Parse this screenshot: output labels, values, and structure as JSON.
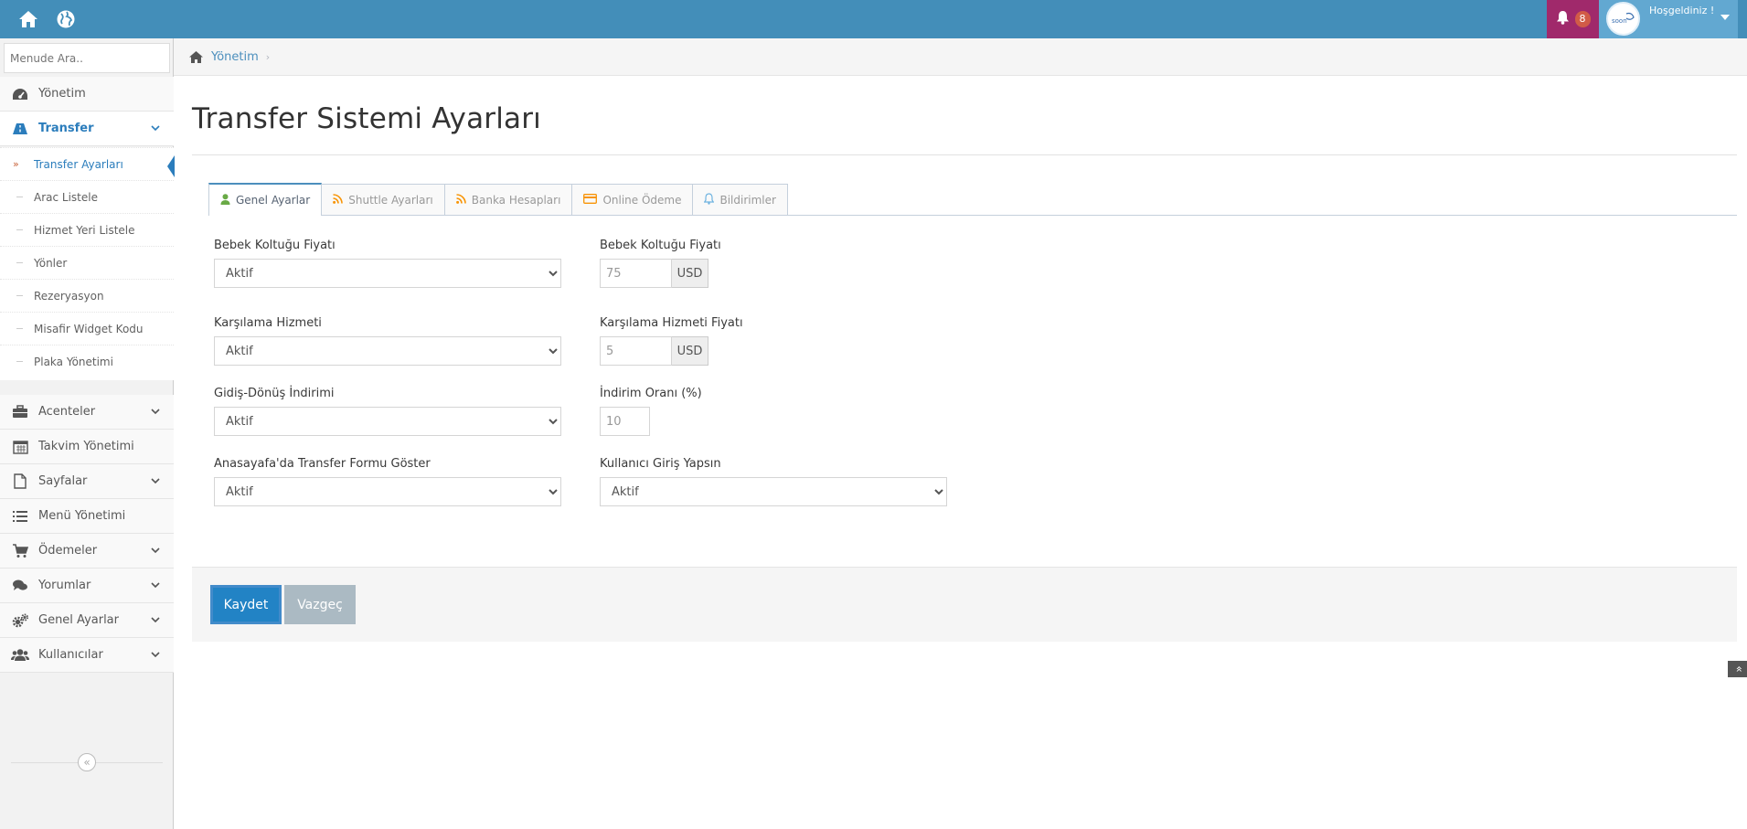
{
  "topbar": {
    "notification_count": "8",
    "welcome_text": "Hoşgeldiniz !",
    "colors": {
      "bar": "#438eb9",
      "notif": "#a0296b",
      "user": "#62a8d1"
    }
  },
  "sidebar": {
    "search_placeholder": "Menude Ara..",
    "items": [
      {
        "label": "Yönetim",
        "icon": "dashboard-icon"
      },
      {
        "label": "Transfer",
        "icon": "road-icon"
      },
      {
        "label": "Acenteler",
        "icon": "briefcase-icon"
      },
      {
        "label": "Takvim Yönetimi",
        "icon": "calendar-icon"
      },
      {
        "label": "Sayfalar",
        "icon": "file-icon"
      },
      {
        "label": "Menü Yönetimi",
        "icon": "list-icon"
      },
      {
        "label": "Ödemeler",
        "icon": "cart-icon"
      },
      {
        "label": "Yorumlar",
        "icon": "comments-icon"
      },
      {
        "label": "Genel Ayarlar",
        "icon": "cogs-icon"
      },
      {
        "label": "Kullanıcılar",
        "icon": "users-icon"
      }
    ],
    "submenu": [
      "Transfer Ayarları",
      "Arac Listele",
      "Hizmet Yeri Listele",
      "Yönler",
      "Rezeryasyon",
      "Misafir Widget Kodu",
      "Plaka Yönetimi"
    ]
  },
  "breadcrumb": {
    "home": "Yönetim"
  },
  "page": {
    "title": "Transfer Sistemi Ayarları"
  },
  "tabs": [
    {
      "label": "Genel Ayarlar",
      "icon": "user-icon"
    },
    {
      "label": "Shuttle Ayarları",
      "icon": "rss-icon"
    },
    {
      "label": "Banka Hesapları",
      "icon": "rss-icon"
    },
    {
      "label": "Online Ödeme",
      "icon": "credit-card-icon"
    },
    {
      "label": "Bildirimler",
      "icon": "bell-icon"
    }
  ],
  "form": {
    "bebek_select": {
      "label": "Bebek Koltuğu Fiyatı",
      "value": "Aktif"
    },
    "bebek_price": {
      "label": "Bebek Koltuğu Fiyatı",
      "value": "75",
      "unit": "USD"
    },
    "karsilama_select": {
      "label": "Karşılama Hizmeti",
      "value": "Aktif"
    },
    "karsilama_price": {
      "label": "Karşılama Hizmeti Fiyatı",
      "value": "5",
      "unit": "USD"
    },
    "gidis_select": {
      "label": "Gidiş-Dönüş İndirimi",
      "value": "Aktif"
    },
    "indirim": {
      "label": "İndirim Oranı (%)",
      "value": "10"
    },
    "anasayfa_select": {
      "label": "Anasayafa'da Transfer Formu Göster",
      "value": "Aktif"
    },
    "kullanici_select": {
      "label": "Kullanıcı Giriş Yapsın",
      "value": "Aktif"
    }
  },
  "actions": {
    "save": "Kaydet",
    "cancel": "Vazgeç"
  }
}
